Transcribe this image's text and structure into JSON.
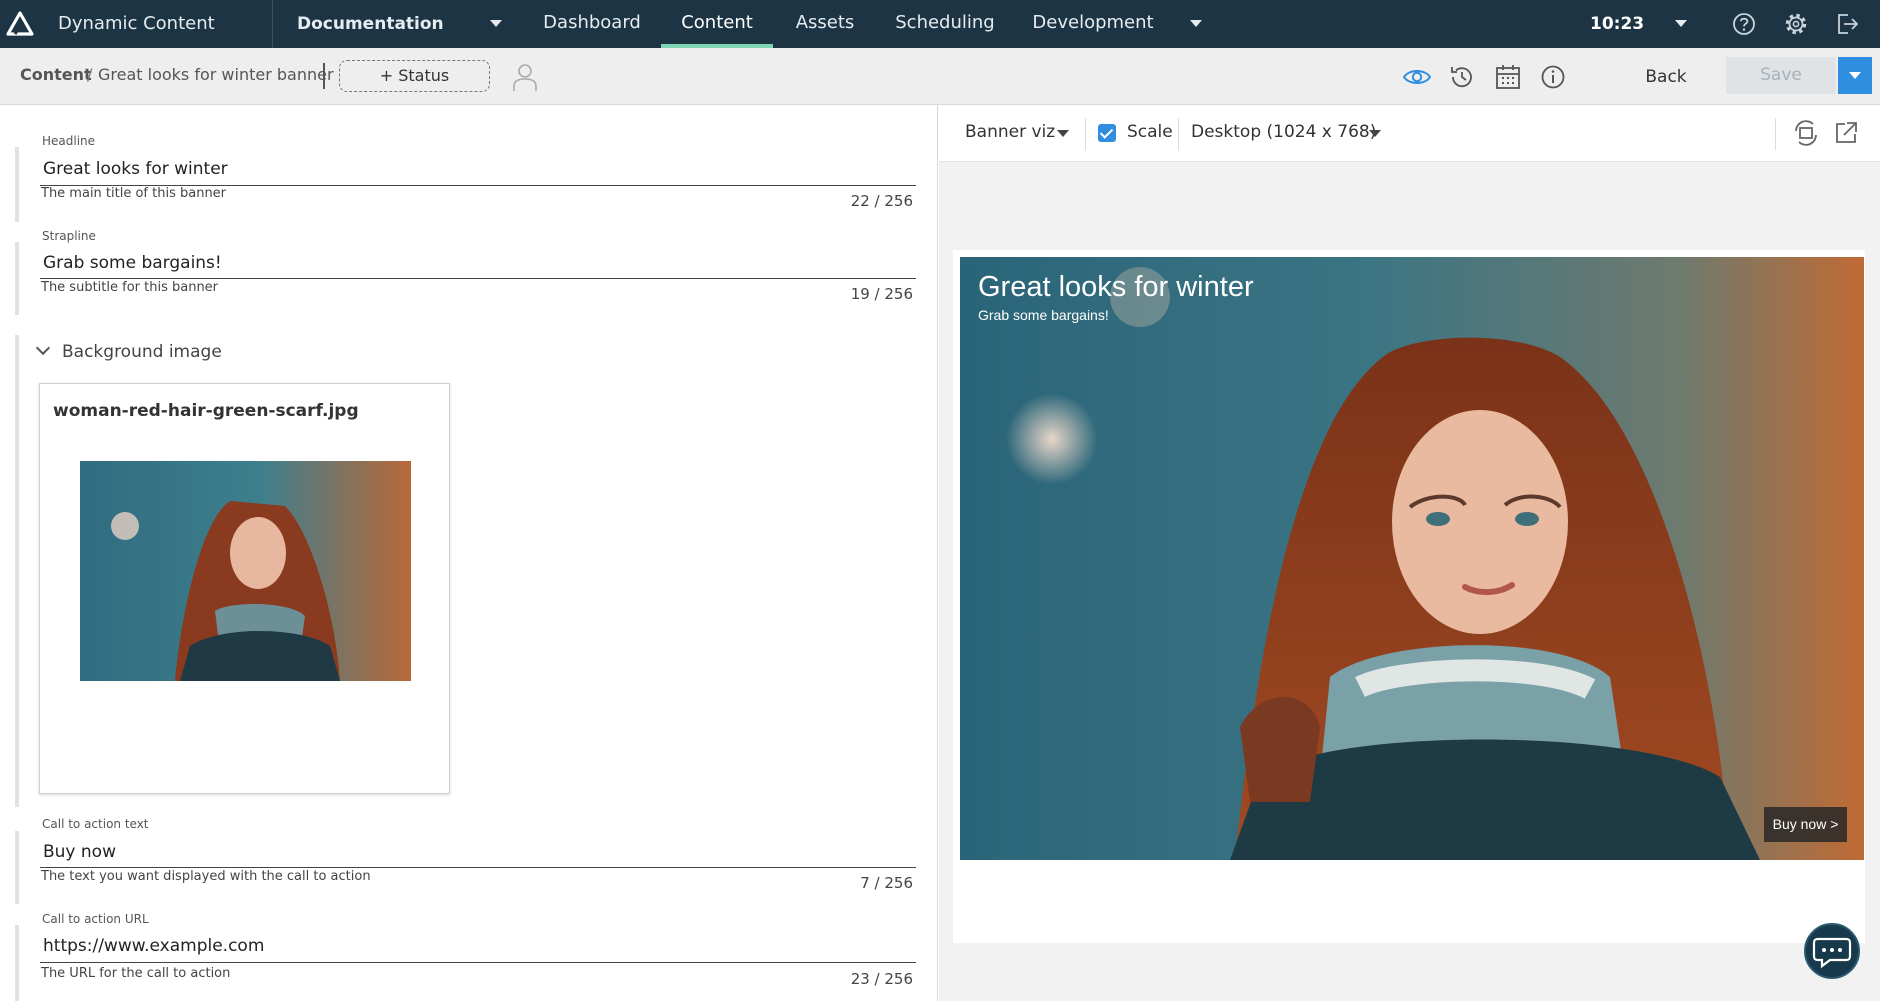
{
  "topnav": {
    "app_title": "Dynamic Content",
    "hub": "Documentation",
    "tabs": [
      "Dashboard",
      "Content",
      "Assets",
      "Scheduling",
      "Development"
    ],
    "active_tab": "Content",
    "clock": "10:23",
    "icons": [
      "help-icon",
      "gear-icon",
      "logout-icon"
    ]
  },
  "subbar": {
    "breadcrumb_root": "Content",
    "breadcrumb_sep": "/",
    "breadcrumb_current": "Great looks for winter banner",
    "status_label": "+ Status",
    "back_label": "Back",
    "save_label": "Save",
    "icons": [
      "eye-icon",
      "history-icon",
      "calendar-icon",
      "info-icon"
    ]
  },
  "form": {
    "headline": {
      "label": "Headline",
      "value": "Great looks for winter",
      "help": "The main title of this banner",
      "count": "22 / 256"
    },
    "strapline": {
      "label": "Strapline",
      "value": "Grab some bargains!",
      "help": "The subtitle for this banner",
      "count": "19 / 256"
    },
    "background": {
      "label": "Background image",
      "filename": "woman-red-hair-green-scarf.jpg"
    },
    "cta_text": {
      "label": "Call to action text",
      "value": "Buy now",
      "help": "The text you want displayed with the call to action",
      "count": "7 / 256"
    },
    "cta_url": {
      "label": "Call to action URL",
      "value": "https://www.example.com",
      "help": "The URL for the call to action",
      "count": "23 / 256"
    }
  },
  "preview": {
    "visualization": "Banner viz",
    "scale_label": "Scale",
    "scale_checked": true,
    "device": "Desktop (1024 x 768)",
    "banner": {
      "headline": "Great looks for winter",
      "strapline": "Grab some bargains!",
      "cta": "Buy now >"
    }
  },
  "colors": {
    "topbar": "#1c3444",
    "active_tab": "#7fd6b2",
    "accent": "#2f8ee0"
  }
}
